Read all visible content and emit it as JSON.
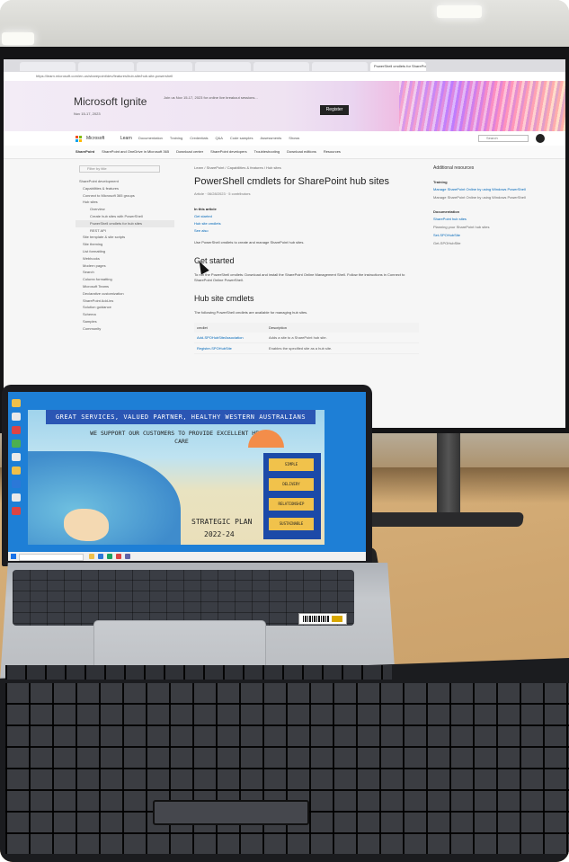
{
  "monitor": {
    "browser_tabs": [
      "",
      "",
      "",
      "",
      "",
      "",
      "PowerShell cmdlets for SharePoint hub sites"
    ],
    "address": "https://learn.microsoft.com/en-us/sharepoint/dev/features/hub-site/hub-site-powershell",
    "banner": {
      "title": "Microsoft Ignite",
      "date": "Nov 15-17, 2023",
      "description": "Join us Nov 15-17, 2023 for online live breakout sessions...",
      "register_label": "Register"
    },
    "nav": {
      "ms_label": "Microsoft",
      "learn_label": "Learn",
      "items": [
        "Documentation",
        "Training",
        "Credentials",
        "Q&A",
        "Code samples",
        "Assessments",
        "Shows"
      ],
      "search_placeholder": "Search"
    },
    "subnav": [
      "SharePoint",
      "SharePoint and OneDrive in Microsoft 365",
      "Download center",
      "SharePoint developers",
      "Troubleshooting",
      "Download editions",
      "Resources"
    ],
    "sidebar": {
      "filter_placeholder": "Filter by title",
      "items": [
        "SharePoint development",
        "Capabilities & features",
        "Connect to Microsoft 365 groups",
        "Hub sites",
        "Overview",
        "Create hub sites with PowerShell",
        "PowerShell cmdlets for hub sites",
        "REST API",
        "Site template & site scripts",
        "Site theming",
        "List formatting",
        "Webhooks",
        "Modern pages",
        "Search",
        "Column formatting",
        "Microsoft Teams",
        "Declarative customization",
        "SharePoint Add-ins",
        "Solution guidance",
        "Schema",
        "Samples",
        "Community"
      ],
      "current_index": 6
    },
    "article": {
      "breadcrumb": "Learn / SharePoint / Capabilities & features / Hub sites",
      "title": "PowerShell cmdlets for SharePoint hub sites",
      "meta": "Article · 06/28/2023 · 5 contributors",
      "in_this_article": "In this article",
      "toc": [
        "Get started",
        "Hub site cmdlets",
        "See also"
      ],
      "intro": "Use PowerShell cmdlets to create and manage SharePoint hub sites.",
      "get_started_heading": "Get started",
      "get_started_text": "To run the PowerShell cmdlets: Download and install the SharePoint Online Management Shell. Follow the instructions in Connect to SharePoint Online PowerShell.",
      "hub_heading": "Hub site cmdlets",
      "hub_text": "The following PowerShell cmdlets are available for managing hub sites.",
      "table_headers": [
        "cmdlet",
        "Description"
      ],
      "table_rows": [
        [
          "Add-SPOHubSiteAssociation",
          "Adds a site to a SharePoint hub site."
        ],
        [
          "Register-SPOHubSite",
          "Enables the specified site as a hub site."
        ]
      ]
    },
    "right_panel": {
      "title": "Additional resources",
      "training_label": "Training",
      "training_links": [
        "Manage SharePoint Online by using Windows PowerShell",
        "Manage SharePoint Online by using Windows PowerShell"
      ],
      "docs_label": "Documentation",
      "docs_links": [
        "SharePoint hub sites",
        "Planning your SharePoint hub sites",
        "Set-SPOHubSite",
        "Get-SPOHubSite"
      ]
    }
  },
  "laptop": {
    "poster": {
      "banner": "GREAT SERVICES, VALUED PARTNER, HEALTHY WESTERN AUSTRALIANS",
      "subtitle": "WE SUPPORT OUR CUSTOMERS TO PROVIDE EXCELLENT HEALTH CARE",
      "cards": [
        "SIMPLE",
        "DELIVERY",
        "RELATIONSHIP",
        "SUSTAINABLE"
      ],
      "plan": "STRATEGIC PLAN",
      "years": "2022-24"
    }
  },
  "colors": {
    "monitor_bezel": "#141416",
    "laptop_wallpaper": "#1e7fd6",
    "poster_banner": "#2a56b4",
    "desk": "#cfa670",
    "keyboard": "#1b1c1f",
    "link": "#0067b8"
  }
}
